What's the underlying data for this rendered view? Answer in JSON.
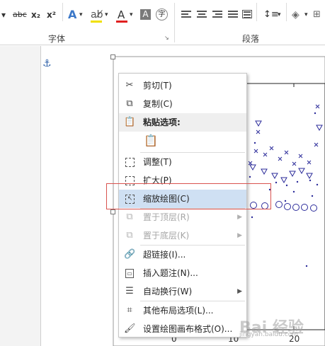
{
  "ribbon": {
    "font_group_label": "字体",
    "paragraph_group_label": "段落",
    "strikethrough": "abc",
    "subscript": "x₂",
    "superscript": "x²",
    "text_effects": "A",
    "font_color": "A",
    "char_shading": "A",
    "enclose_char": "字",
    "font_color_hex": "#e02020",
    "highlight_hex": "#f0e000"
  },
  "menu": {
    "items": [
      {
        "label": "剪切(T)",
        "icon": "scissors-icon",
        "enabled": true
      },
      {
        "label": "复制(C)",
        "icon": "copy-icon",
        "enabled": true
      },
      {
        "label": "粘贴选项:",
        "icon": "paste-icon",
        "enabled": true
      },
      {
        "label": "调整(T)",
        "icon": "fit-icon",
        "enabled": true
      },
      {
        "label": "扩大(P)",
        "icon": "expand-icon",
        "enabled": true
      },
      {
        "label": "缩放绘图(C)",
        "icon": "scale-drawing-icon",
        "enabled": true
      },
      {
        "label": "置于顶层(R)",
        "icon": "bring-to-front-icon",
        "enabled": false
      },
      {
        "label": "置于底层(K)",
        "icon": "send-to-back-icon",
        "enabled": false
      },
      {
        "label": "超链接(I)...",
        "icon": "hyperlink-icon",
        "enabled": true
      },
      {
        "label": "插入题注(N)...",
        "icon": "caption-icon",
        "enabled": true
      },
      {
        "label": "自动换行(W)",
        "icon": "wrap-text-icon",
        "enabled": true
      },
      {
        "label": "其他布局选项(L)...",
        "icon": "layout-options-icon",
        "enabled": true
      },
      {
        "label": "设置绘图画布格式(O)...",
        "icon": "format-canvas-icon",
        "enabled": true
      }
    ],
    "highlight_color": "#cfe0f3"
  },
  "plot": {
    "x_ticks": [
      "0",
      "10",
      "20"
    ]
  },
  "watermark": {
    "text": "Bai 经验",
    "sub": "jingyan.baidu.com"
  },
  "colors": {
    "marker": "#2b2b9a",
    "callout_border": "#d9534f"
  }
}
